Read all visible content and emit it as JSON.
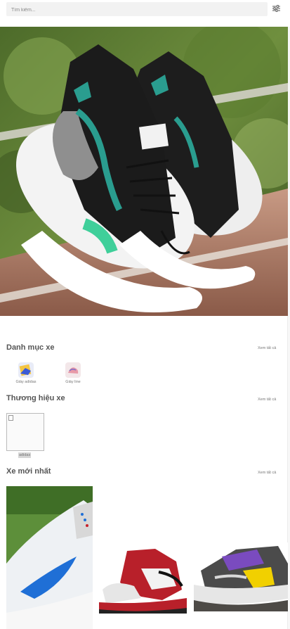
{
  "search": {
    "placeholder": "Tìm kiếm..."
  },
  "icons": {
    "filter": "sliders-icon",
    "broken_image": "broken-image-icon"
  },
  "categories": {
    "title": "Danh mục xe",
    "see_all": "Xem tất cả",
    "items": [
      {
        "label": "Giày adidas"
      },
      {
        "label": "Giày line"
      }
    ]
  },
  "brands": {
    "title": "Thương hiệu xe",
    "see_all": "Xem tất cả",
    "items": [
      {
        "label": "adidas"
      }
    ]
  },
  "latest": {
    "title": "Xe mới nhất",
    "see_all": "Xem tất cả"
  },
  "colors": {
    "accent": "#2a9d8f",
    "shoe_red": "#b8202a",
    "shoe_blue": "#1f6fd6"
  }
}
